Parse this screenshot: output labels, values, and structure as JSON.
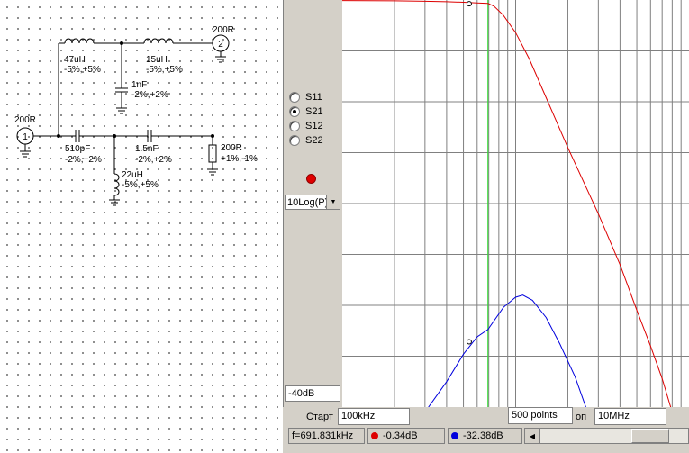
{
  "schematic": {
    "port1": {
      "label": "200R",
      "number": "1"
    },
    "port2": {
      "label": "200R",
      "number": "2"
    },
    "components": [
      {
        "name": "47uH",
        "tolerance": "-5%,+5%"
      },
      {
        "name": "15uH",
        "tolerance": "-5%,+5%"
      },
      {
        "name": "1nF",
        "tolerance": "-2%,+2%"
      },
      {
        "name": "510pF",
        "tolerance": "-2%,+2%"
      },
      {
        "name": "1.5nF",
        "tolerance": "-2%,+2%"
      },
      {
        "name": "22uH",
        "tolerance": "-5%,+5%"
      },
      {
        "name": "200R",
        "tolerance": "+1%,-1%"
      }
    ]
  },
  "controls": {
    "params": [
      {
        "label": "S11",
        "selected": false
      },
      {
        "label": "S21",
        "selected": true
      },
      {
        "label": "S12",
        "selected": false
      },
      {
        "label": "S22",
        "selected": false
      }
    ],
    "scale_select": "10Log(P)",
    "ymin": "-40dB"
  },
  "sweep": {
    "start_label": "Старт",
    "start_value": "100kHz",
    "points_value": "500 points",
    "stop_label": "оп",
    "stop_value": "10MHz"
  },
  "status": {
    "frequency": "f=691.831kHz",
    "marker_red": "-0.34dB",
    "marker_blue": "-32.38dB"
  },
  "colors": {
    "red_trace": "#dd0000",
    "blue_trace": "#0000dd",
    "cursor": "#33dd33",
    "grid": "#808080"
  },
  "chart_data": {
    "type": "line",
    "xlabel": "",
    "ylabel": "",
    "x_scale": "log",
    "xlim_hz": [
      100000,
      10000000
    ],
    "ylim_db": [
      -40,
      0
    ],
    "cursor_hz": 691831,
    "series": [
      {
        "color": "#dd0000",
        "points": [
          [
            100000,
            -0.05
          ],
          [
            200000,
            -0.08
          ],
          [
            300000,
            -0.12
          ],
          [
            400000,
            -0.17
          ],
          [
            500000,
            -0.22
          ],
          [
            600000,
            -0.28
          ],
          [
            691831,
            -0.34
          ],
          [
            750000,
            -0.6
          ],
          [
            850000,
            -1.5
          ],
          [
            1000000,
            -3.2
          ],
          [
            1200000,
            -5.8
          ],
          [
            1500000,
            -9.6
          ],
          [
            2000000,
            -14.5
          ],
          [
            3000000,
            -21
          ],
          [
            4000000,
            -26
          ],
          [
            5000000,
            -30.5
          ],
          [
            6000000,
            -34
          ],
          [
            7000000,
            -37.2
          ],
          [
            8000000,
            -40.5
          ]
        ]
      },
      {
        "color": "#0000dd",
        "points": [
          [
            300000,
            -40.5
          ],
          [
            400000,
            -37.5
          ],
          [
            500000,
            -34.8
          ],
          [
            600000,
            -33.1
          ],
          [
            691831,
            -32.38
          ],
          [
            850000,
            -30.2
          ],
          [
            1000000,
            -29.2
          ],
          [
            1100000,
            -29
          ],
          [
            1250000,
            -29.5
          ],
          [
            1500000,
            -31.2
          ],
          [
            1800000,
            -33.8
          ],
          [
            2200000,
            -37
          ],
          [
            2600000,
            -40.5
          ]
        ]
      }
    ]
  }
}
